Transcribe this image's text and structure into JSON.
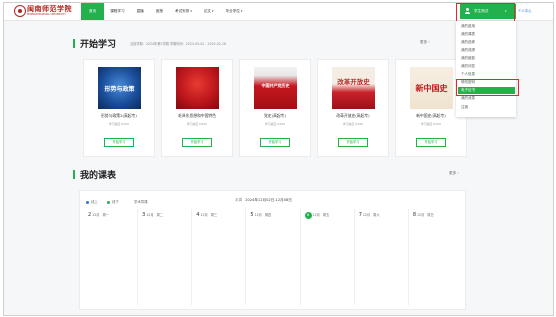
{
  "logo": {
    "name": "闽南师范学院",
    "subtitle": "MINNAN NORMAL UNIVERSITY"
  },
  "nav": {
    "items": [
      {
        "label": "首页",
        "active": true
      },
      {
        "label": "课程学习",
        "caret": ""
      },
      {
        "label": "直播",
        "caret": ""
      },
      {
        "label": "函授",
        "caret": ""
      },
      {
        "label": "考试安排",
        "caret": "▾"
      },
      {
        "label": "论文",
        "caret": "▾"
      },
      {
        "label": "毕业学位",
        "caret": "▾"
      }
    ]
  },
  "user": {
    "name": "学生测试",
    "caret": "▾",
    "link": "个人中心"
  },
  "user_menu": {
    "items": [
      {
        "label": "我的费用",
        "active": false
      },
      {
        "label": "我的课表",
        "active": false
      },
      {
        "label": "我的选修",
        "active": false
      },
      {
        "label": "我的成绩",
        "active": false
      },
      {
        "label": "我的缴费",
        "active": false
      },
      {
        "label": "我的问答",
        "active": false
      },
      {
        "label": "个人信息",
        "active": false
      },
      {
        "label": "修改密码",
        "active": false
      },
      {
        "label": "电子证书",
        "active": true
      },
      {
        "label": "我的消息",
        "active": false
      },
      {
        "label": "注销",
        "active": false
      }
    ]
  },
  "start_section": {
    "title": "开始学习",
    "meta": "当前学期：2024年第2学期  学期时间：2024-09-02 - 2025-02-16",
    "more": "更多 ›"
  },
  "courses": [
    {
      "title": "形势与政策2(高起专)",
      "progress": "学习进度 0/100",
      "cover_text": "形势与政策",
      "cover_color": "#1a4f9c",
      "button": "开始学习"
    },
    {
      "title": "毛泽东思想和中国特色",
      "progress": "学习进度 0/100",
      "cover_text": "",
      "cover_color": "#b8141b",
      "button": "开始学习"
    },
    {
      "title": "党史(高起专)",
      "progress": "学习进度 0/100",
      "cover_text": "中国共产党历史",
      "cover_color": "#c7171f",
      "button": "开始学习"
    },
    {
      "title": "改革开放史(高起专)",
      "progress": "学习进度 0/100",
      "cover_text": "改革开放史",
      "cover_color": "#c9232b",
      "button": "开始学习"
    },
    {
      "title": "新中国史(高起专)",
      "progress": "学习进度 0/100",
      "cover_text": "新中国史",
      "cover_color": "#f3eadc",
      "button": "开始学习"
    }
  ],
  "schedule_section": {
    "title": "我的课表",
    "more": "更多 ›"
  },
  "schedule": {
    "legend": [
      {
        "label": "线上",
        "color": "#2b7bd6"
      },
      {
        "label": "线下",
        "color": "#22b14c"
      },
      {
        "label": "学术导课",
        "color": ""
      }
    ],
    "week_prefix": "本周",
    "week_range": "2024年12月02日-12月08日",
    "days": [
      {
        "num": "2",
        "date": "12月",
        "weekday": "周一",
        "today": false
      },
      {
        "num": "3",
        "date": "12月",
        "weekday": "周二",
        "today": false
      },
      {
        "num": "4",
        "date": "12月",
        "weekday": "周三",
        "today": false
      },
      {
        "num": "5",
        "date": "12月",
        "weekday": "周四",
        "today": false
      },
      {
        "num": "6",
        "date": "12月",
        "weekday": "周五",
        "today": true
      },
      {
        "num": "7",
        "date": "12月",
        "weekday": "周六",
        "today": false
      },
      {
        "num": "8",
        "date": "12月",
        "weekday": "周日",
        "today": false
      }
    ]
  }
}
